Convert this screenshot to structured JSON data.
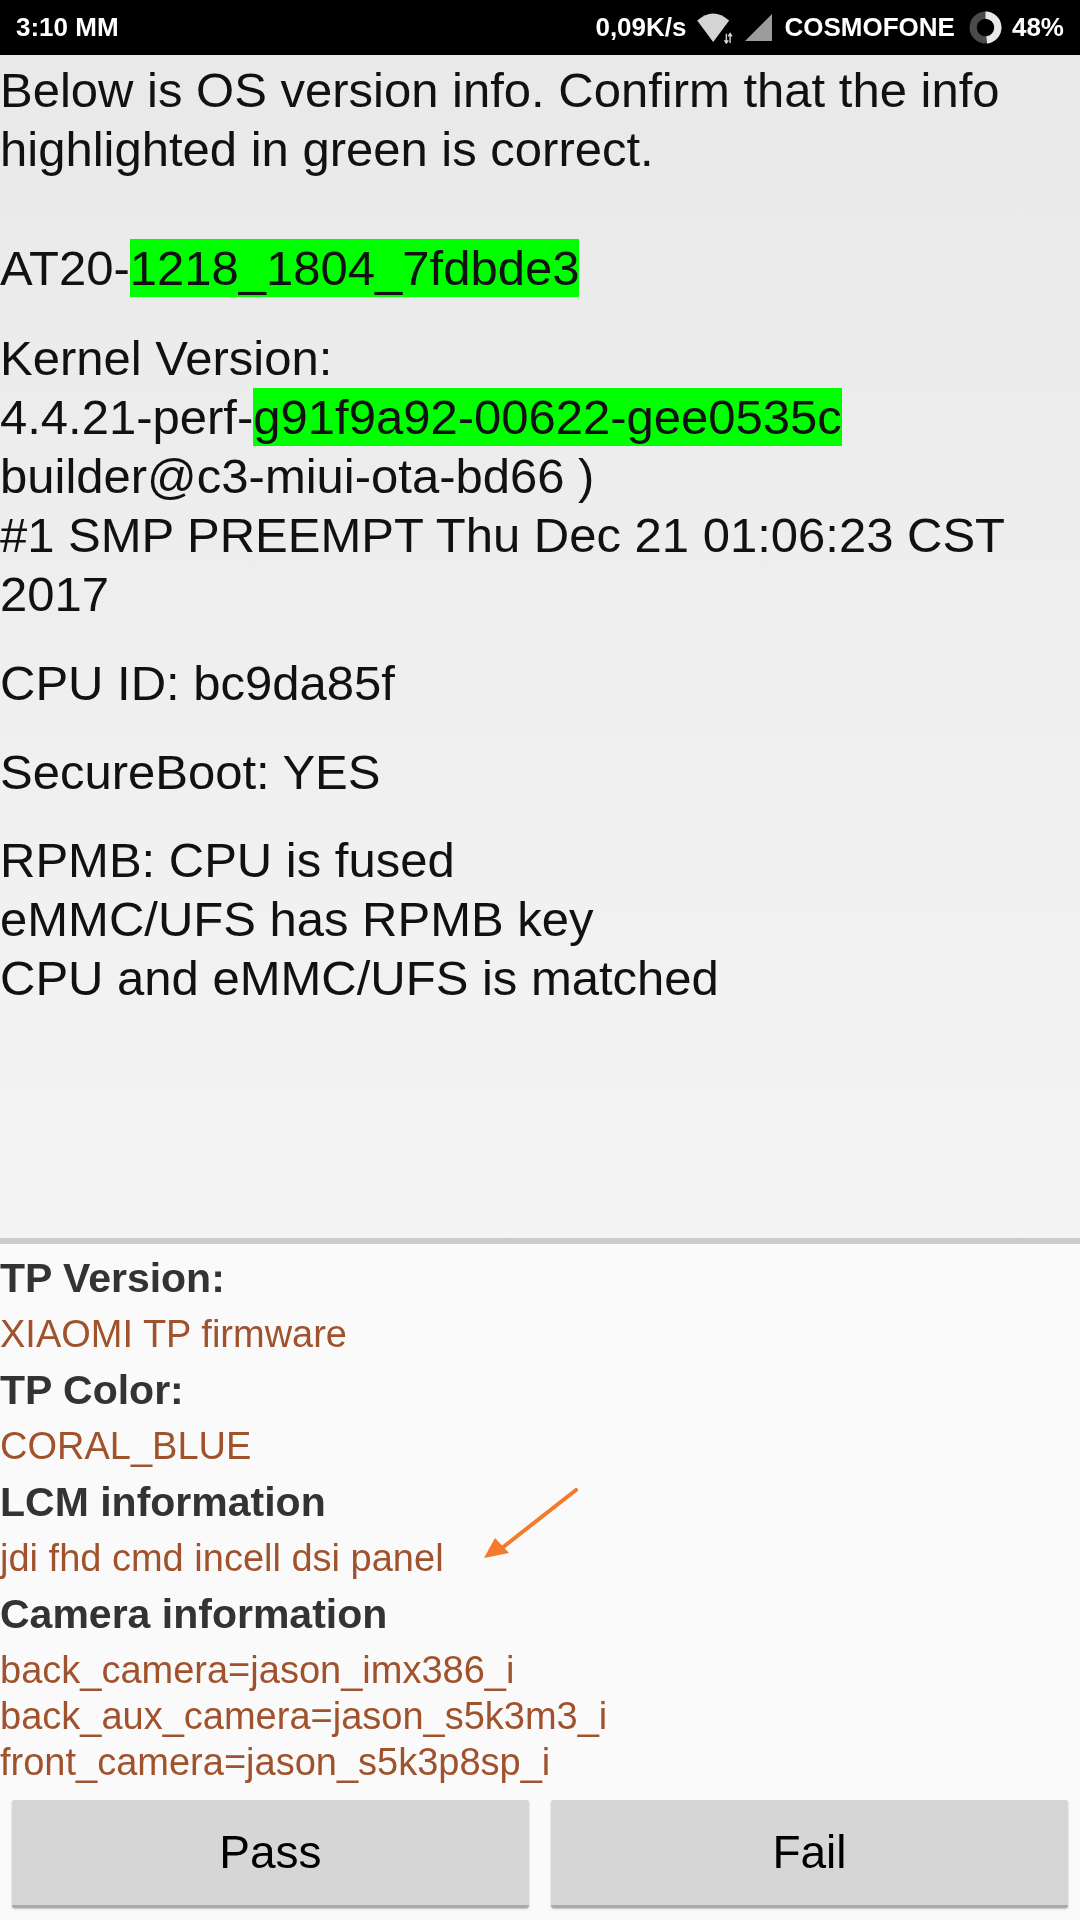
{
  "status_bar": {
    "time": "3:10 MM",
    "net_speed": "0,09K/s",
    "carrier": "COSMOFONE",
    "battery": "48%"
  },
  "os_info": {
    "intro": "Below is OS version info. Confirm that the info highlighted in green is correct.",
    "build_line": [
      {
        "text": "AT20-",
        "highlighted": false
      },
      {
        "text": "1218_1804_7fdbde3",
        "highlighted": true
      }
    ],
    "kernel": {
      "label": "Kernel Version:",
      "version_line": [
        {
          "text": "4.4.21-perf-",
          "highlighted": false
        },
        {
          "text": "g91f9a92-00622-gee0535c",
          "highlighted": true
        }
      ],
      "details": [
        "builder@c3-miui-ota-bd66 )",
        "#1 SMP PREEMPT Thu Dec 21 01:06:23 CST 2017"
      ]
    },
    "cpu_id": "CPU ID: bc9da85f",
    "secure_boot": "SecureBoot: YES",
    "rpmb": [
      "RPMB: CPU is fused",
      "eMMC/UFS has RPMB key",
      "CPU and eMMC/UFS is matched"
    ]
  },
  "hardware_info": [
    {
      "heading": "TP Version:",
      "values": [
        "XIAOMI TP firmware"
      ]
    },
    {
      "heading": "TP Color:",
      "values": [
        "CORAL_BLUE"
      ]
    },
    {
      "heading": "LCM information",
      "values": [
        "jdi fhd cmd incell dsi panel"
      ]
    },
    {
      "heading": "Camera information",
      "values": [
        "back_camera=jason_imx386_i",
        "back_aux_camera=jason_s5k3m3_i",
        "front_camera=jason_s5k3p8sp_i"
      ]
    }
  ],
  "buttons": [
    "Pass",
    "Fail"
  ]
}
